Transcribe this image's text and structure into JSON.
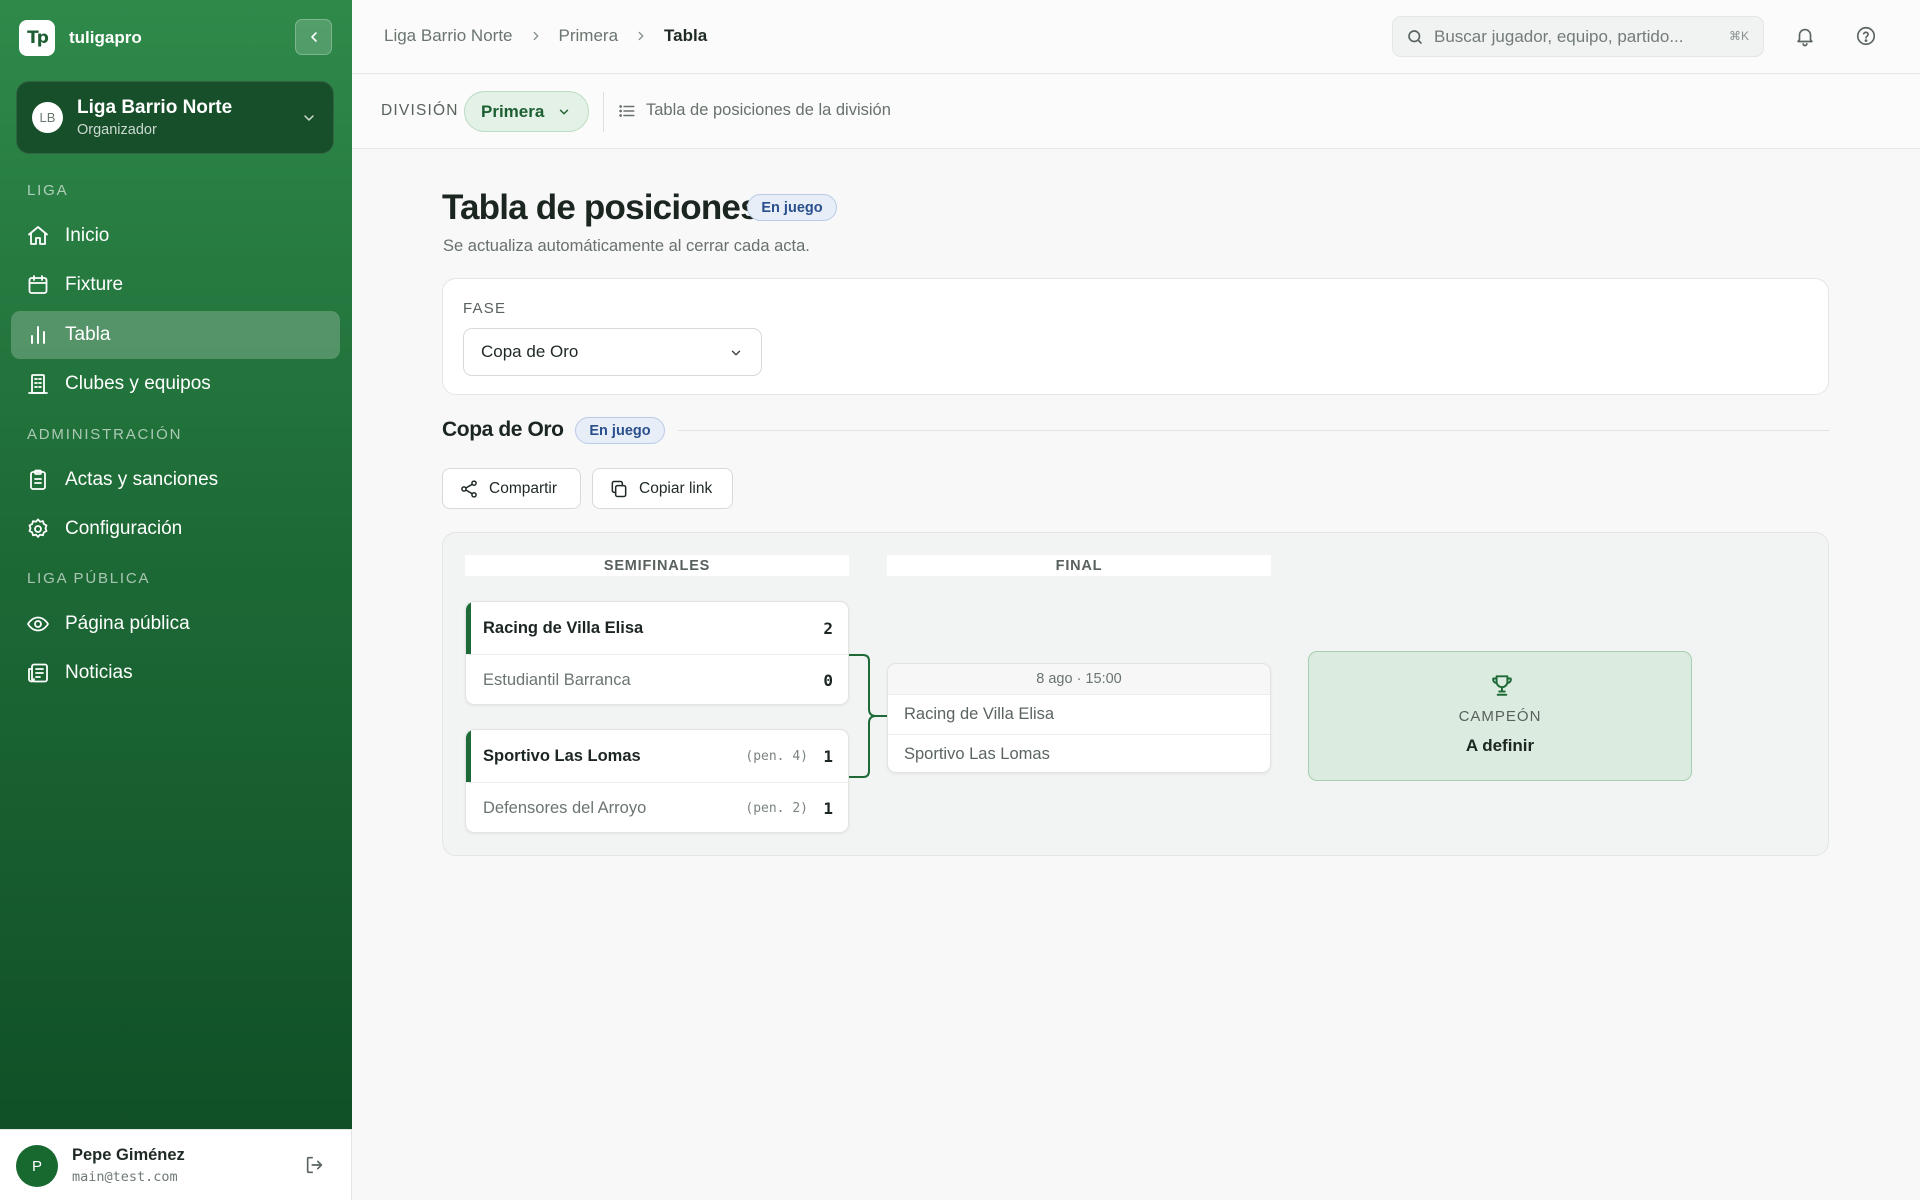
{
  "app": {
    "name": "tuligapro",
    "logo_text": "Tp"
  },
  "org": {
    "name": "Liga Barrio Norte",
    "role": "Organizador",
    "initials": "LB"
  },
  "sidebar": {
    "sections": [
      "LIGA",
      "ADMINISTRACIÓN",
      "LIGA PÚBLICA"
    ],
    "items": [
      {
        "label": "Inicio",
        "icon": "home-icon"
      },
      {
        "label": "Fixture",
        "icon": "calendar-icon"
      },
      {
        "label": "Tabla",
        "icon": "bar-chart-icon",
        "active": true
      },
      {
        "label": "Clubes y equipos",
        "icon": "building-icon"
      },
      {
        "label": "Actas y sanciones",
        "icon": "clipboard-icon"
      },
      {
        "label": "Configuración",
        "icon": "gear-icon"
      },
      {
        "label": "Página pública",
        "icon": "eye-icon"
      },
      {
        "label": "Noticias",
        "icon": "newspaper-icon"
      }
    ]
  },
  "user": {
    "initial": "P",
    "name": "Pepe Giménez",
    "email": "main@test.com"
  },
  "breadcrumb": [
    "Liga Barrio Norte",
    "Primera",
    "Tabla"
  ],
  "search": {
    "placeholder": "Buscar jugador, equipo, partido...",
    "shortcut": "⌘K"
  },
  "division": {
    "label": "DIVISIÓN",
    "selected": "Primera",
    "description": "Tabla de posiciones de la división"
  },
  "page": {
    "title": "Tabla de posiciones",
    "status": "En juego",
    "subtitle": "Se actualiza automáticamente al cerrar cada acta."
  },
  "fase": {
    "label": "FASE",
    "selected": "Copa de Oro"
  },
  "phase": {
    "title": "Copa de Oro",
    "status": "En juego",
    "share_label": "Compartir",
    "copy_label": "Copiar link"
  },
  "bracket": {
    "rounds": [
      "SEMIFINALES",
      "FINAL"
    ],
    "semifinals": [
      {
        "home": {
          "team": "Racing de Villa Elisa",
          "score": "2",
          "pen": ""
        },
        "away": {
          "team": "Estudiantil Barranca",
          "score": "0",
          "pen": ""
        }
      },
      {
        "home": {
          "team": "Sportivo Las Lomas",
          "score": "1",
          "pen": "(pen. 4)"
        },
        "away": {
          "team": "Defensores del Arroyo",
          "score": "1",
          "pen": "(pen. 2)"
        }
      }
    ],
    "final": {
      "date": "8 ago · 15:00",
      "home": "Racing de Villa Elisa",
      "away": "Sportivo Las Lomas"
    },
    "champion": {
      "label": "CAMPEÓN",
      "value": "A definir"
    }
  },
  "colors": {
    "brand_green": "#1d6a36",
    "badge_blue": "#2a4f8c",
    "champion_bg": "#dcebdf"
  }
}
